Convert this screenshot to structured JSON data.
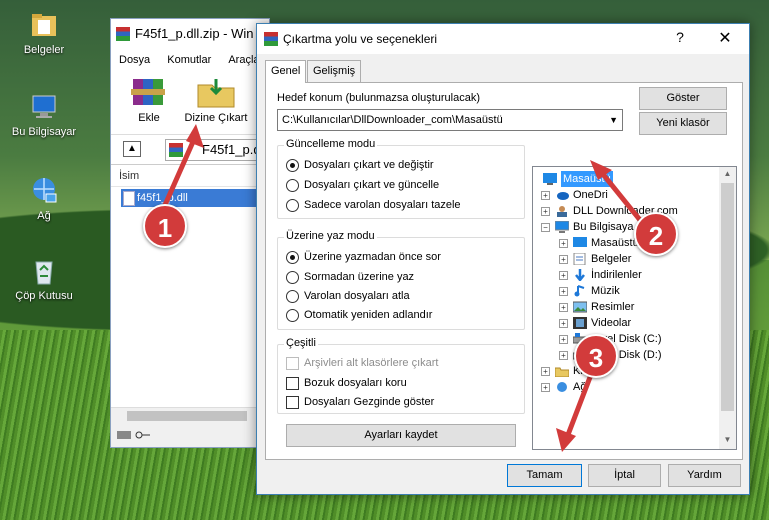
{
  "desktop": {
    "icons": [
      {
        "label": "Belgeler",
        "icon": "folder-documents-icon"
      },
      {
        "label": "Bu Bilgisayar",
        "icon": "computer-icon"
      },
      {
        "label": "Ağ",
        "icon": "network-icon"
      },
      {
        "label": "Çöp Kutusu",
        "icon": "recycle-bin-icon"
      }
    ]
  },
  "winrar": {
    "title": "F45f1_p.dll.zip - Win",
    "menu": [
      "Dosya",
      "Komutlar",
      "Araçla"
    ],
    "tools": {
      "add": "Ekle",
      "extract": "Dizine Çıkart"
    },
    "address": "F45f1_p.dll",
    "column": "İsim",
    "file": "f45f1_p.dll"
  },
  "dialog": {
    "title": "Çıkartma yolu ve seçenekleri",
    "help": "?",
    "close": "✕",
    "tabs": [
      "Genel",
      "Gelişmiş"
    ],
    "dest_label": "Hedef konum (bulunmazsa oluşturulacak)",
    "dest_value": "C:\\Kullanıcılar\\DllDownloader_com\\Masaüstü",
    "show_button": "Göster",
    "new_folder_button": "Yeni klasör",
    "update_group": {
      "title": "Güncelleme modu",
      "options": [
        "Dosyaları çıkart ve değiştir",
        "Dosyaları çıkart ve güncelle",
        "Sadece varolan dosyaları tazele"
      ],
      "selected": 0
    },
    "overwrite_group": {
      "title": "Üzerine yaz modu",
      "options": [
        "Üzerine yazmadan önce sor",
        "Sormadan üzerine yaz",
        "Varolan dosyaları atla",
        "Otomatik yeniden adlandır"
      ],
      "selected": 0
    },
    "misc_group": {
      "title": "Çeşitli",
      "options": [
        {
          "label": "Arşivleri alt klasörlere çıkart",
          "checked": false,
          "disabled": true
        },
        {
          "label": "Bozuk dosyaları koru",
          "checked": false,
          "disabled": false
        },
        {
          "label": "Dosyaları Gezginde göster",
          "checked": false,
          "disabled": false
        }
      ]
    },
    "save_button": "Ayarları kaydet",
    "tree": [
      {
        "label": "Masaüstü",
        "level": 0,
        "selected": true,
        "icon": "desktop-icon"
      },
      {
        "label": "OneDri",
        "level": 1,
        "icon": "onedrive-icon"
      },
      {
        "label": "DLL Downloader.com",
        "level": 1,
        "icon": "user-icon"
      },
      {
        "label": "Bu Bilgisaya",
        "level": 1,
        "icon": "computer-icon",
        "expanded": true
      },
      {
        "label": "Masaüstü",
        "level": 2,
        "icon": "desktop-icon"
      },
      {
        "label": "Belgeler",
        "level": 2,
        "icon": "documents-icon"
      },
      {
        "label": "İndirilenler",
        "level": 2,
        "icon": "downloads-icon"
      },
      {
        "label": "Müzik",
        "level": 2,
        "icon": "music-icon"
      },
      {
        "label": "Resimler",
        "level": 2,
        "icon": "pictures-icon"
      },
      {
        "label": "Videolar",
        "level": 2,
        "icon": "videos-icon"
      },
      {
        "label": "Yerel Disk (C:)",
        "level": 2,
        "icon": "drive-icon"
      },
      {
        "label": "Yerel Disk (D:)",
        "level": 2,
        "icon": "drive-icon"
      },
      {
        "label": "Kita",
        "level": 1,
        "icon": "libraries-icon"
      },
      {
        "label": "Ağ",
        "level": 1,
        "icon": "network-icon"
      }
    ],
    "buttons": {
      "ok": "Tamam",
      "cancel": "İptal",
      "help": "Yardım"
    }
  },
  "annotations": [
    "1",
    "2",
    "3"
  ],
  "colors": {
    "accent": "#d23b3b",
    "selection": "#3399ff"
  }
}
